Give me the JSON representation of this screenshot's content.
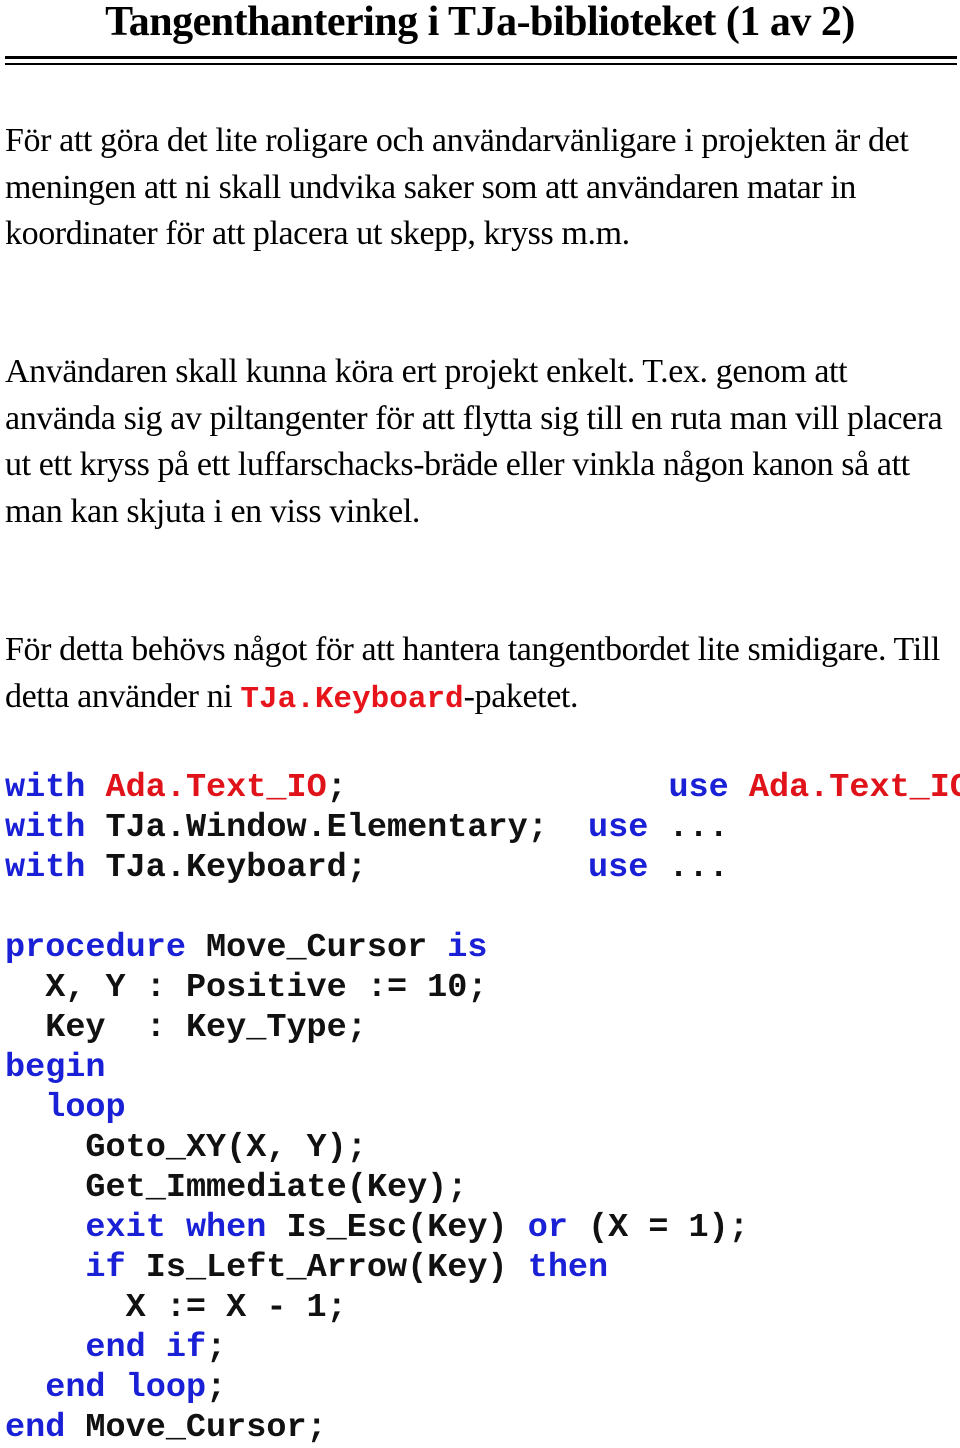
{
  "title": "Tangenthantering i TJa-biblioteket (1 av 2)",
  "paragraphs": {
    "p1": "För att göra det lite roligare och användarvänligare i projekten är det meningen att ni skall undvika saker som att användaren matar in koordinater för att placera ut skepp, kryss m.m.",
    "p2": "Användaren skall kunna köra ert projekt enkelt. T.ex. genom att använda sig av piltangenter för att flytta sig till en ruta man vill placera ut ett kryss på ett luffarschacks-bräde eller vinkla någon kanon så att man kan skjuta i en viss vinkel.",
    "p3_before": "För detta behövs något för att hantera tangentbordet lite smidigare. Till detta använder ni ",
    "p3_code": "TJa.Keyboard",
    "p3_after": "-paketet."
  },
  "colors": {
    "keyword": "#1a20d6",
    "package_highlight": "#e0121a",
    "text": "#000000"
  },
  "imports": [
    {
      "with_kw": "with",
      "with_pkg": "Ada.Text_IO",
      "with_pkg_highlight": true,
      "with_end": ";",
      "pad": "                ",
      "use_kw": "use",
      "use_rest": "Ada.Text_IO",
      "use_highlight": true,
      "use_end": ";"
    },
    {
      "with_kw": "with",
      "with_pkg": "TJa.Window.Elementary",
      "with_pkg_highlight": false,
      "with_end": ";",
      "pad": "  ",
      "use_kw": "use",
      "use_rest": "...",
      "use_highlight": false,
      "use_end": ""
    },
    {
      "with_kw": "with",
      "with_pkg": "TJa.Keyboard",
      "with_pkg_highlight": false,
      "with_end": ";",
      "pad": "           ",
      "use_kw": "use",
      "use_rest": "...",
      "use_highlight": false,
      "use_end": ""
    }
  ],
  "procedure": [
    {
      "indent": "",
      "parts": [
        {
          "t": "procedure",
          "k": true
        },
        {
          "t": " Move_Cursor ",
          "k": false
        },
        {
          "t": "is",
          "k": true
        }
      ]
    },
    {
      "indent": "  ",
      "parts": [
        {
          "t": "X, Y : Positive := 10;",
          "k": false
        }
      ]
    },
    {
      "indent": "  ",
      "parts": [
        {
          "t": "Key  : Key_Type;",
          "k": false
        }
      ]
    },
    {
      "indent": "",
      "parts": [
        {
          "t": "begin",
          "k": true
        }
      ]
    },
    {
      "indent": "  ",
      "parts": [
        {
          "t": "loop",
          "k": true
        }
      ]
    },
    {
      "indent": "    ",
      "parts": [
        {
          "t": "Goto_XY(X, Y);",
          "k": false
        }
      ]
    },
    {
      "indent": "    ",
      "parts": [
        {
          "t": "Get_Immediate(Key);",
          "k": false
        }
      ]
    },
    {
      "indent": "    ",
      "parts": [
        {
          "t": "exit",
          "k": true
        },
        {
          "t": " ",
          "k": false
        },
        {
          "t": "when",
          "k": true
        },
        {
          "t": " Is_Esc(Key) ",
          "k": false
        },
        {
          "t": "or",
          "k": true
        },
        {
          "t": " (X = 1);",
          "k": false
        }
      ]
    },
    {
      "indent": "    ",
      "parts": [
        {
          "t": "if",
          "k": true
        },
        {
          "t": " Is_Left_Arrow(Key) ",
          "k": false
        },
        {
          "t": "then",
          "k": true
        }
      ]
    },
    {
      "indent": "      ",
      "parts": [
        {
          "t": "X := X - 1;",
          "k": false
        }
      ]
    },
    {
      "indent": "    ",
      "parts": [
        {
          "t": "end",
          "k": true
        },
        {
          "t": " ",
          "k": false
        },
        {
          "t": "if",
          "k": true
        },
        {
          "t": ";",
          "k": false
        }
      ]
    },
    {
      "indent": "  ",
      "parts": [
        {
          "t": "end",
          "k": true
        },
        {
          "t": " ",
          "k": false
        },
        {
          "t": "loop",
          "k": true
        },
        {
          "t": ";",
          "k": false
        }
      ]
    },
    {
      "indent": "",
      "parts": [
        {
          "t": "end",
          "k": true
        },
        {
          "t": " Move_Cursor;",
          "k": false
        }
      ]
    }
  ]
}
